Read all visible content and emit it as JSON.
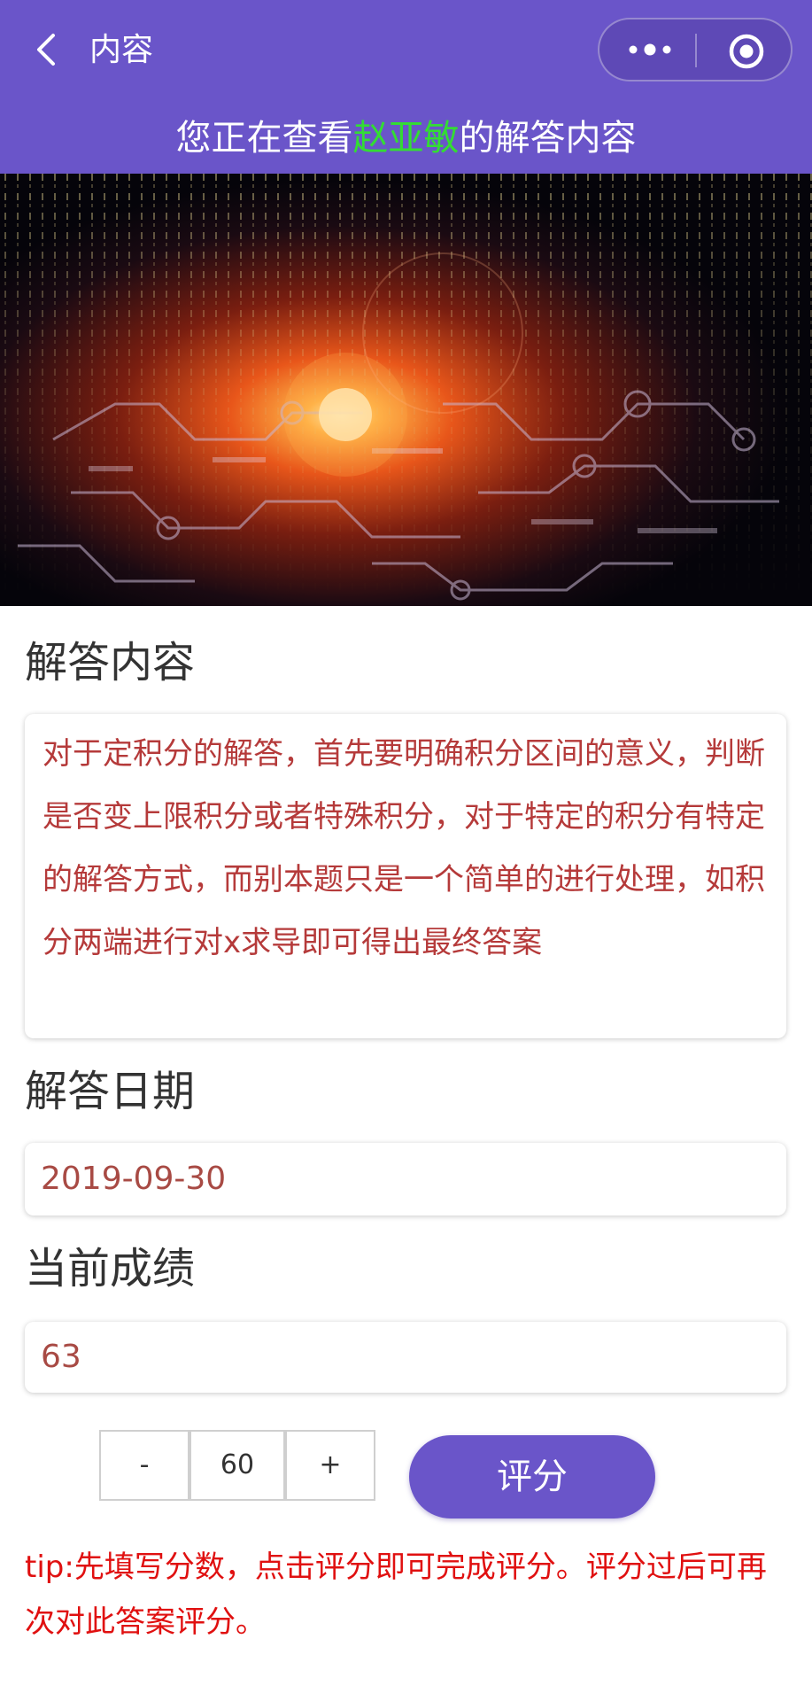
{
  "nav": {
    "title": "内容"
  },
  "viewing": {
    "prefix": "您正在查看",
    "name": "赵亚敏",
    "suffix": "的解答内容"
  },
  "answer": {
    "label": "解答内容",
    "text": "对于定积分的解答，首先要明确积分区间的意义，判断是否变上限积分或者特殊积分，对于特定的积分有特定的解答方式，而别本题只是一个简单的进行处理，如积分两端进行对x求导即可得出最终答案"
  },
  "date": {
    "label": "解答日期",
    "value": "2019-09-30"
  },
  "score": {
    "label": "当前成绩",
    "value": "63"
  },
  "stepper": {
    "minus": "-",
    "value": "60",
    "plus": "+"
  },
  "rate_button": "评分",
  "tip": "tip:先填写分数，点击评分即可完成评分。评分过后可再次对此答案评分。",
  "colors": {
    "accent": "#6a55c9",
    "name_highlight": "#33dd33",
    "answer_text": "#b53a3a",
    "tip": "#e01010"
  },
  "icons": [
    "back-icon",
    "more-icon",
    "target-icon"
  ]
}
